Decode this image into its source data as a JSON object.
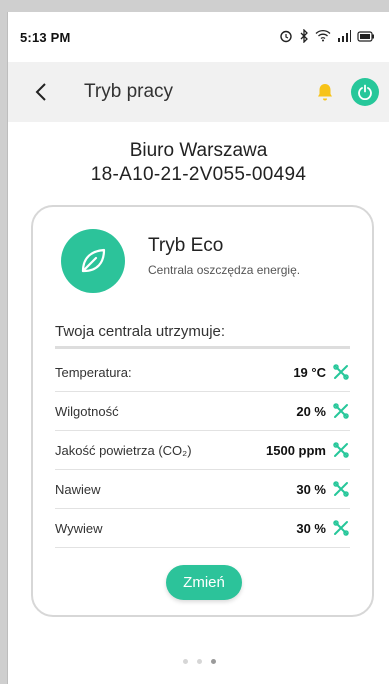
{
  "status": {
    "time": "5:13 PM",
    "icons": [
      "alarm-icon",
      "bluetooth-icon",
      "wifi-icon",
      "signal-icon",
      "battery-icon"
    ]
  },
  "header": {
    "title": "Tryb pracy",
    "accent": "#26c79a",
    "bell_color": "#f7c318"
  },
  "device": {
    "name": "Biuro Warszawa",
    "serial": "18-A10-21-2V055-00494"
  },
  "mode": {
    "title": "Tryb Eco",
    "description": "Centrala oszczędza energię."
  },
  "maintain_label": "Twoja centrala utrzymuje:",
  "params": [
    {
      "label": "Temperatura:",
      "value": "19 °C"
    },
    {
      "label": "Wilgotność",
      "value": "20 %"
    },
    {
      "label": "Jakość powietrza (CO₂)",
      "value": "1500 ppm"
    },
    {
      "label": "Nawiew",
      "value": "30 %"
    },
    {
      "label": "Wywiew",
      "value": "30 %"
    }
  ],
  "change_button": "Zmień",
  "pager": {
    "count": 3,
    "active": 3
  }
}
